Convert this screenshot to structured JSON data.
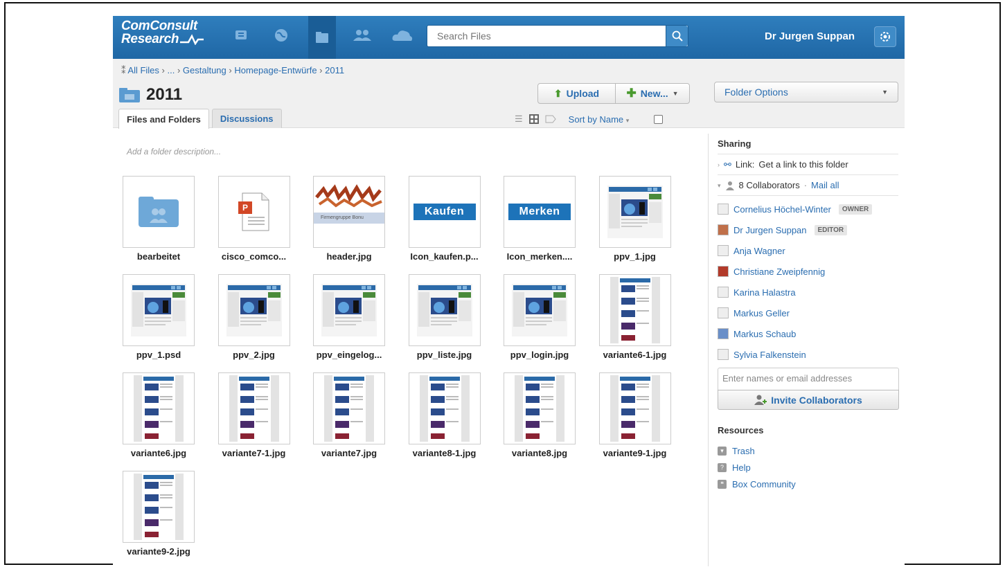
{
  "brand": {
    "line1": "ComConsult",
    "line2": "Research"
  },
  "nav_icons": [
    "updates-icon",
    "globe-icon",
    "files-icon",
    "people-icon",
    "cloud-icon"
  ],
  "search": {
    "placeholder": "Search Files"
  },
  "user": {
    "name": "Dr Jurgen Suppan"
  },
  "breadcrumb": {
    "items": [
      "All Files",
      "...",
      "Gestaltung",
      "Homepage-Entwürfe",
      "2011"
    ]
  },
  "folder": {
    "title": "2011",
    "description_placeholder": "Add a folder description..."
  },
  "toolbar": {
    "upload_label": "Upload",
    "new_label": "New...",
    "folder_options_label": "Folder Options",
    "sort_label": "Sort by Name"
  },
  "tabs": [
    {
      "label": "Files and Folders",
      "active": true
    },
    {
      "label": "Discussions",
      "active": false
    }
  ],
  "files": [
    {
      "name": "bearbeitet",
      "kind": "folder"
    },
    {
      "name": "cisco_comco...",
      "kind": "ppt"
    },
    {
      "name": "header.jpg",
      "kind": "header",
      "thumb_text": "Firmengruppe   Bonu"
    },
    {
      "name": "Icon_kaufen.p...",
      "kind": "label",
      "thumb_text": "Kaufen"
    },
    {
      "name": "Icon_merken....",
      "kind": "label",
      "thumb_text": "Merken"
    },
    {
      "name": "ppv_1.jpg",
      "kind": "page"
    },
    {
      "name": "ppv_1.psd",
      "kind": "page"
    },
    {
      "name": "ppv_2.jpg",
      "kind": "page"
    },
    {
      "name": "ppv_eingelog...",
      "kind": "page"
    },
    {
      "name": "ppv_liste.jpg",
      "kind": "page"
    },
    {
      "name": "ppv_login.jpg",
      "kind": "page"
    },
    {
      "name": "variante6-1.jpg",
      "kind": "narrow"
    },
    {
      "name": "variante6.jpg",
      "kind": "narrow"
    },
    {
      "name": "variante7-1.jpg",
      "kind": "narrow"
    },
    {
      "name": "variante7.jpg",
      "kind": "narrow"
    },
    {
      "name": "variante8-1.jpg",
      "kind": "narrow"
    },
    {
      "name": "variante8.jpg",
      "kind": "narrow"
    },
    {
      "name": "variante9-1.jpg",
      "kind": "narrow"
    },
    {
      "name": "variante9-2.jpg",
      "kind": "narrow"
    }
  ],
  "sharing": {
    "title": "Sharing",
    "link_text": "Link:",
    "link_action": "Get a link to this folder",
    "collaborators_label": "8 Collaborators",
    "mail_all": "Mail all",
    "collaborators": [
      {
        "name": "Cornelius Höchel-Winter",
        "role": "OWNER"
      },
      {
        "name": "Dr Jurgen Suppan",
        "role": "EDITOR"
      },
      {
        "name": "Anja Wagner",
        "role": ""
      },
      {
        "name": "Christiane Zweipfennig",
        "role": ""
      },
      {
        "name": "Karina Halastra",
        "role": ""
      },
      {
        "name": "Markus Geller",
        "role": ""
      },
      {
        "name": "Markus Schaub",
        "role": ""
      },
      {
        "name": "Sylvia Falkenstein",
        "role": ""
      }
    ],
    "invite_placeholder": "Enter names or email addresses",
    "invite_button": "Invite Collaborators"
  },
  "resources": {
    "title": "Resources",
    "items": [
      {
        "label": "Trash",
        "icon": "trash-icon"
      },
      {
        "label": "Help",
        "icon": "help-icon"
      },
      {
        "label": "Box Community",
        "icon": "community-icon"
      }
    ]
  },
  "colors": {
    "topbar": "#2a74b5",
    "link": "#2a6db0"
  }
}
